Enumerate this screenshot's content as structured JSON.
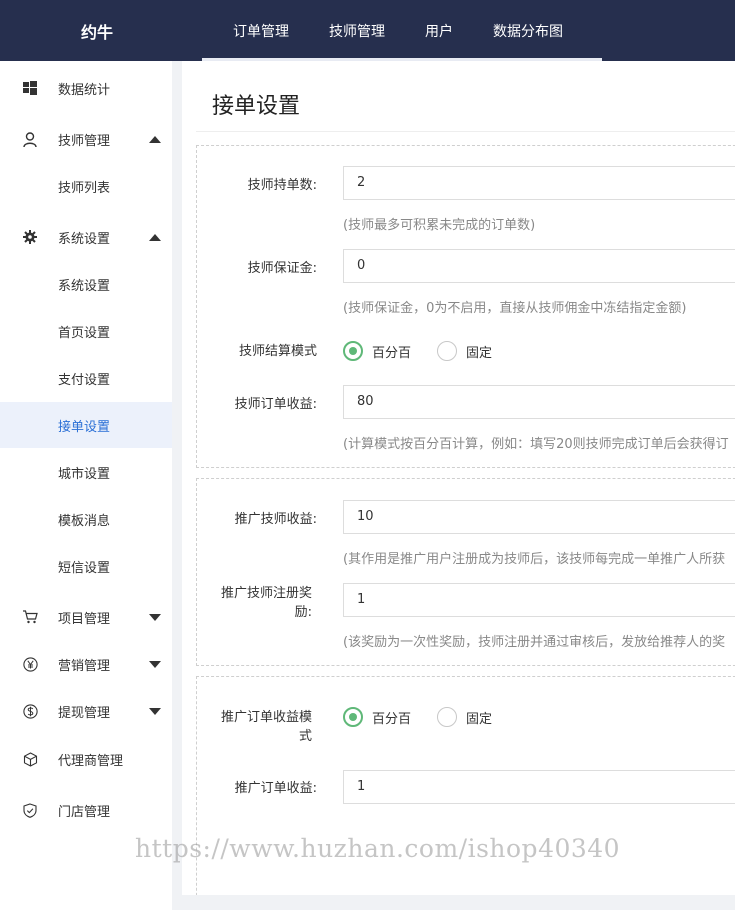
{
  "header": {
    "logo": "约牛",
    "nav": [
      "订单管理",
      "技师管理",
      "用户",
      "数据分布图"
    ]
  },
  "sidebar": {
    "items": [
      {
        "label": "数据统计",
        "icon": "windows-grid-icon"
      },
      {
        "label": "技师管理",
        "icon": "user-icon",
        "caret": "up"
      },
      {
        "label": "技师列表"
      },
      {
        "label": "系统设置",
        "icon": "gear-icon",
        "caret": "up"
      },
      {
        "label": "系统设置"
      },
      {
        "label": "首页设置"
      },
      {
        "label": "支付设置"
      },
      {
        "label": "接单设置",
        "active": true
      },
      {
        "label": "城市设置"
      },
      {
        "label": "模板消息"
      },
      {
        "label": "短信设置"
      },
      {
        "label": "项目管理",
        "icon": "cart-icon",
        "caret": "down"
      },
      {
        "label": "营销管理",
        "icon": "yen-icon",
        "caret": "down"
      },
      {
        "label": "提现管理",
        "icon": "dollar-icon",
        "caret": "down"
      },
      {
        "label": "代理商管理",
        "icon": "cube-icon"
      },
      {
        "label": "门店管理",
        "icon": "shield-icon"
      }
    ]
  },
  "main": {
    "title": "接单设置",
    "form": {
      "order_limit": {
        "label": "技师持单数:",
        "value": "2",
        "hint": "(技师最多可积累未完成的订单数)"
      },
      "deposit": {
        "label": "技师保证金:",
        "value": "0",
        "hint": "(技师保证金，0为不启用，直接从技师佣金中冻结指定金额)"
      },
      "settle_mode": {
        "label": "技师结算模式",
        "options": [
          "百分百",
          "固定"
        ],
        "selected": "百分百"
      },
      "order_income": {
        "label": "技师订单收益:",
        "value": "80",
        "hint": "(计算模式按百分百计算，例如：填写20则技师完成订单后会获得订"
      },
      "promo_income": {
        "label": "推广技师收益:",
        "value": "10",
        "hint": "(其作用是推广用户注册成为技师后，该技师每完成一单推广人所获"
      },
      "promo_reward": {
        "label_line1": "推广技师注册奖",
        "label_line2": "励:",
        "value": "1",
        "hint": "(该奖励为一次性奖励，技师注册并通过审核后，发放给推荐人的奖"
      },
      "promo_order_mode": {
        "label_line1": "推广订单收益模",
        "label_line2": "式",
        "options": [
          "百分百",
          "固定"
        ],
        "selected": "百分百"
      },
      "promo_order_income": {
        "label": "推广订单收益:",
        "value": "1"
      }
    }
  },
  "watermark": "https://www.huzhan.com/ishop40340"
}
